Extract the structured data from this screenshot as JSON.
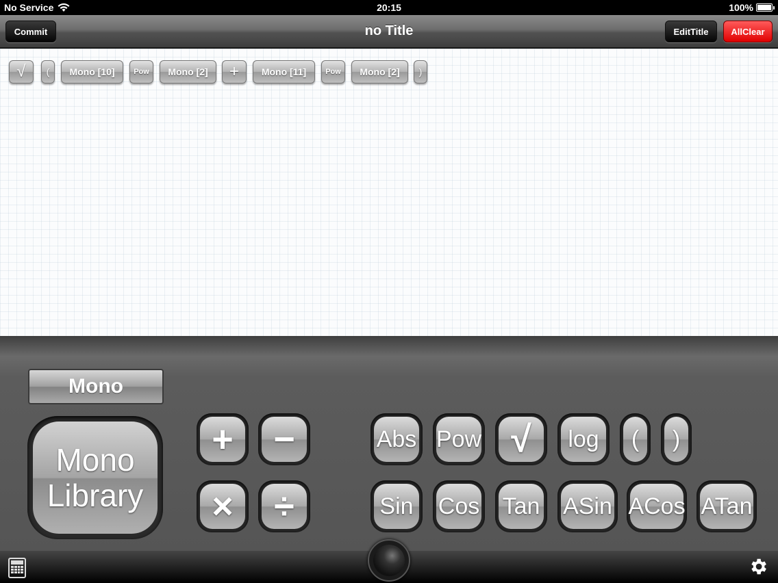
{
  "status": {
    "carrier": "No Service",
    "time": "20:15",
    "battery": "100%"
  },
  "nav": {
    "commit": "Commit",
    "title": "no Title",
    "edit_title": "EditTitle",
    "all_clear": "AllClear"
  },
  "expression": [
    {
      "id": "t1",
      "label": "√",
      "kind": "sym"
    },
    {
      "id": "t2",
      "label": "(",
      "kind": "par"
    },
    {
      "id": "t3",
      "label": "Mono [10]",
      "kind": "mono"
    },
    {
      "id": "t4",
      "label": "Pow",
      "kind": "small"
    },
    {
      "id": "t5",
      "label": "Mono [2]",
      "kind": "mono"
    },
    {
      "id": "t6",
      "label": "+",
      "kind": "sym"
    },
    {
      "id": "t7",
      "label": "Mono [11]",
      "kind": "mono"
    },
    {
      "id": "t8",
      "label": "Pow",
      "kind": "small"
    },
    {
      "id": "t9",
      "label": "Mono [2]",
      "kind": "mono"
    },
    {
      "id": "t10",
      "label": ")",
      "kind": "par"
    }
  ],
  "keyboard": {
    "mono_tab": "Mono",
    "library_line1": "Mono",
    "library_line2": "Library",
    "ops": {
      "plus": "+",
      "minus": "−",
      "times": "×",
      "divide": "÷"
    },
    "funcs": {
      "abs": "Abs",
      "pow": "Pow",
      "sqrt": "√",
      "log": "log",
      "lparen": "(",
      "rparen": ")",
      "sin": "Sin",
      "cos": "Cos",
      "tan": "Tan",
      "asin": "ASin",
      "acos": "ACos",
      "atan": "ATan"
    }
  }
}
